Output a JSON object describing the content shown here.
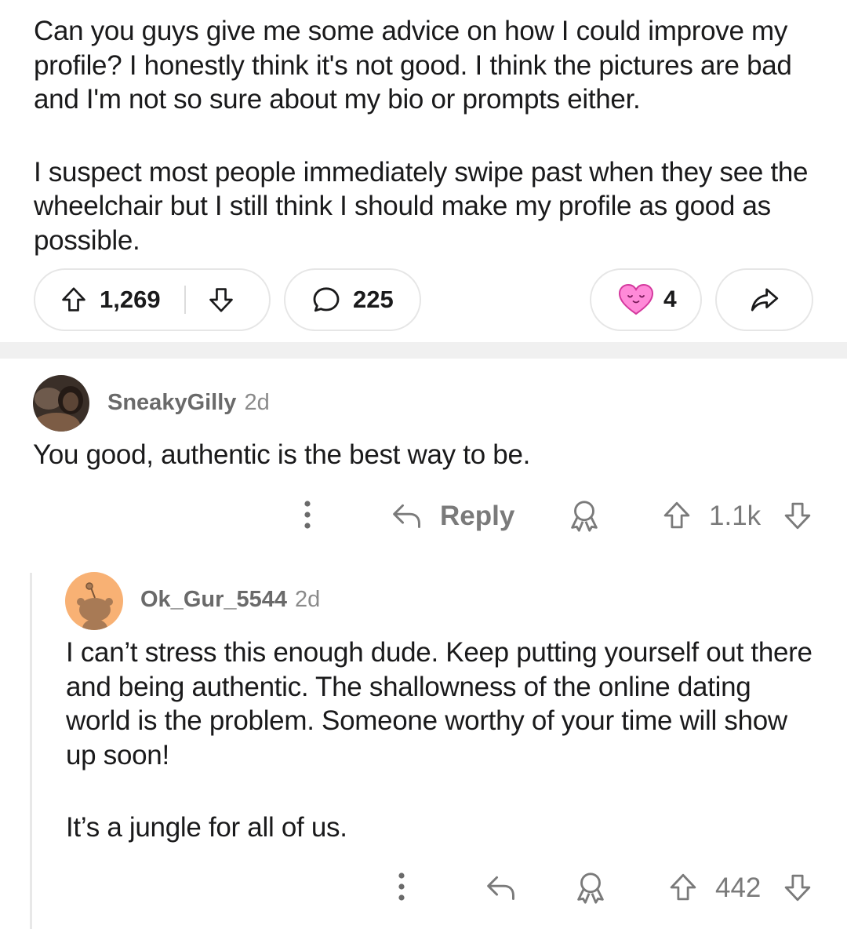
{
  "post": {
    "paragraphs": [
      "Can you guys give me some advice on how I could improve my profile? I honestly think it's not good. I think the pictures are bad and I'm not so sure about my bio or prompts either.",
      "I suspect most people immediately swipe past when they see the wheelchair but I still think I should make my profile as good as possible."
    ],
    "upvotes": "1,269",
    "comments": "225",
    "awards": "4"
  },
  "comments": [
    {
      "username": "SneakyGilly",
      "time": "2d",
      "text": "You good, authentic is the best way to be.",
      "reply_label": "Reply",
      "score": "1.1k"
    },
    {
      "username": "Ok_Gur_5544",
      "time": "2d",
      "paragraphs": [
        "I can’t stress this enough dude. Keep putting yourself out there and being authentic. The shallowness of the online dating world is the problem. Someone worthy of your time will show up soon!",
        "It’s a jungle for all of us."
      ],
      "score": "442"
    }
  ],
  "colors": {
    "text": "#1a1a1b",
    "meta": "#7a7a7a",
    "border": "#e6e6e6",
    "snoo_bg": "#f8b174",
    "award_pink": "#ff7ad9"
  },
  "icons": [
    "upvote-icon",
    "downvote-icon",
    "comment-icon",
    "heart-award-icon",
    "share-icon",
    "more-icon",
    "reply-icon",
    "award-icon"
  ]
}
